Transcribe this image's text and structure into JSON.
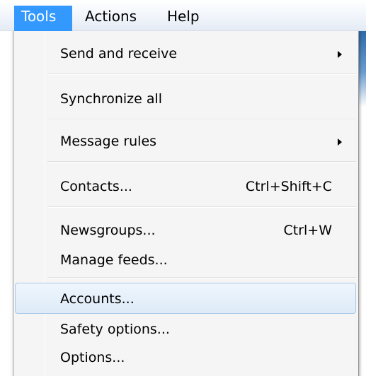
{
  "menubar": {
    "items": [
      {
        "label": "Tools"
      },
      {
        "label": "Actions"
      },
      {
        "label": "Help"
      }
    ]
  },
  "tools_menu": {
    "items": [
      {
        "label": "Send and receive",
        "shortcut": "",
        "submenu": true
      },
      {
        "label": "Synchronize all",
        "shortcut": "",
        "submenu": false
      },
      {
        "label": "Message rules",
        "shortcut": "",
        "submenu": true
      },
      {
        "label": "Contacts...",
        "shortcut": "Ctrl+Shift+C",
        "submenu": false
      },
      {
        "label": "Newsgroups...",
        "shortcut": "Ctrl+W",
        "submenu": false
      },
      {
        "label": "Manage feeds...",
        "shortcut": "",
        "submenu": false
      },
      {
        "label": "Accounts...",
        "shortcut": "",
        "submenu": false,
        "highlighted": true
      },
      {
        "label": "Safety options...",
        "shortcut": "",
        "submenu": false
      },
      {
        "label": "Options...",
        "shortcut": "",
        "submenu": false
      }
    ]
  },
  "colors": {
    "menubar_selected_bg": "#3399ff",
    "hover_border": "#a8c8e8",
    "menu_bg": "#f5f5f5"
  }
}
